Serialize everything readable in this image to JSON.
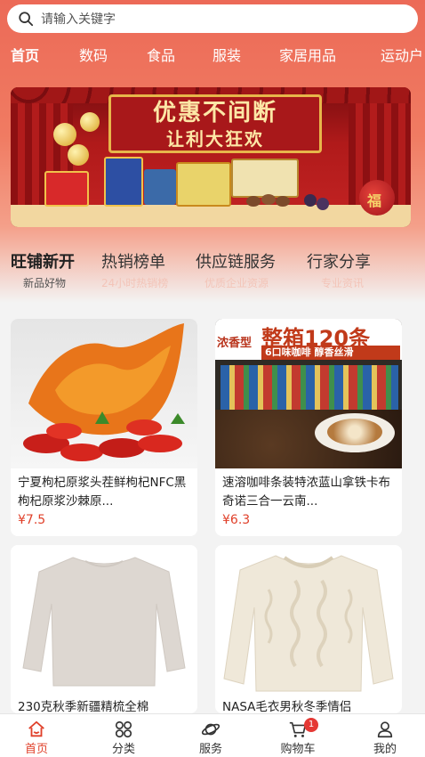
{
  "search": {
    "placeholder": "请输入关键字"
  },
  "categories": [
    "首页",
    "数码",
    "食品",
    "服装",
    "家居用品",
    "运动户"
  ],
  "banner": {
    "line1": "优惠不间断",
    "line2": "让利大狂欢",
    "tag": "福"
  },
  "sections": [
    {
      "title": "旺铺新开",
      "subtitle": "新品好物"
    },
    {
      "title": "热销榜单",
      "subtitle": "24小时热销榜"
    },
    {
      "title": "供应链服务",
      "subtitle": "优质企业资源"
    },
    {
      "title": "行家分享",
      "subtitle": "专业资讯"
    }
  ],
  "products": [
    {
      "name": "宁夏枸杞原浆头茬鲜枸杞NFC黑枸杞原浆沙棘原...",
      "price": "¥7.5"
    },
    {
      "name": "速溶咖啡条装特浓蓝山拿铁卡布奇诺三合一云南...",
      "price": "¥6.3",
      "pack_line1": "浓香型",
      "pack_line2": "整箱120条",
      "pack_line3": "6口味咖啡 醇香丝滑"
    },
    {
      "name": "230克秋季新疆精梳全棉",
      "price": ""
    },
    {
      "name": "NASA毛衣男秋冬季情侣",
      "price": ""
    }
  ],
  "bottom_nav": [
    {
      "label": "首页"
    },
    {
      "label": "分类"
    },
    {
      "label": "服务"
    },
    {
      "label": "购物车",
      "badge": "1"
    },
    {
      "label": "我的"
    }
  ],
  "colors": {
    "accent": "#e0402a",
    "header": "#ec6a57"
  }
}
